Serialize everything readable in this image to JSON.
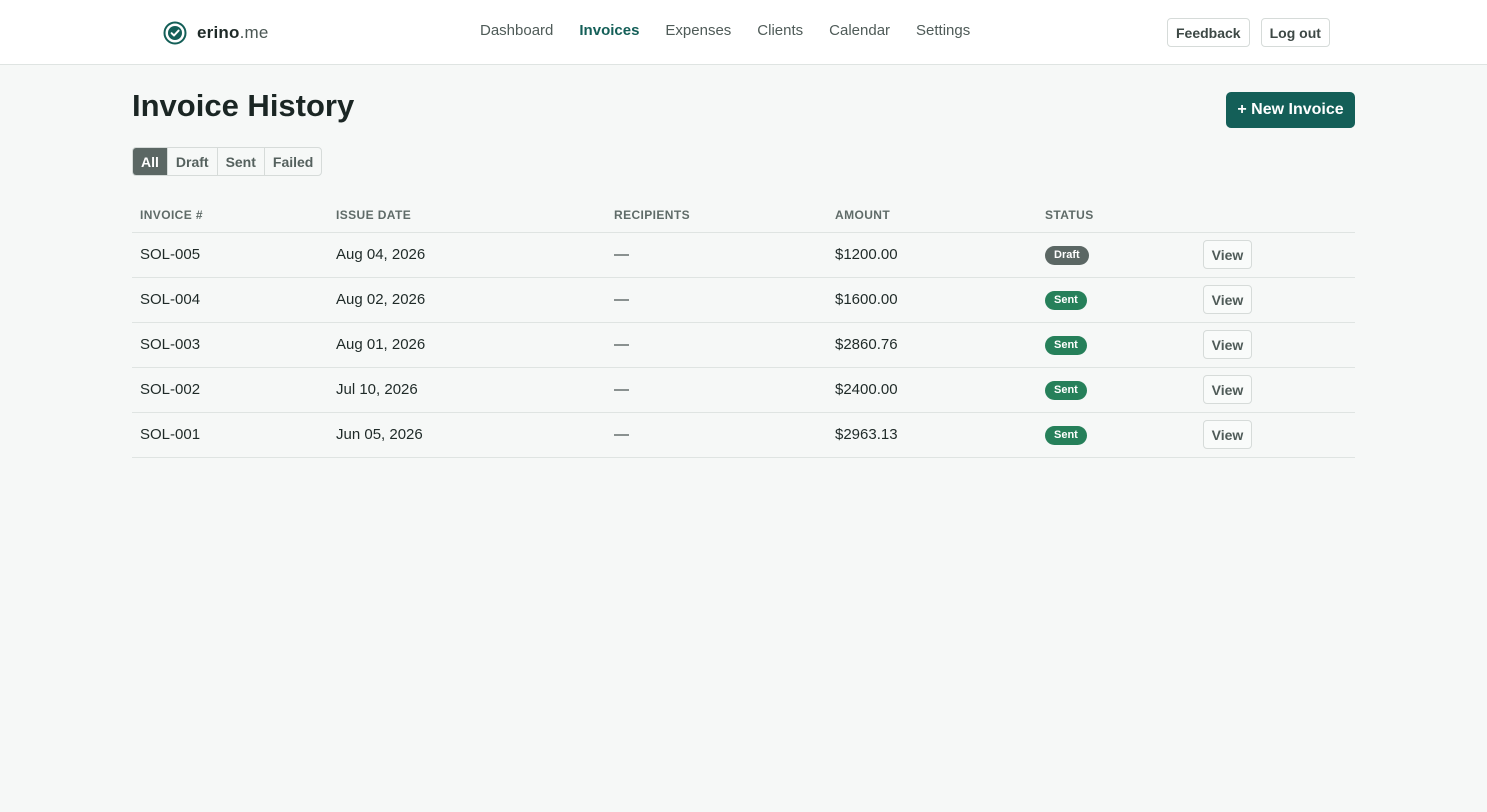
{
  "brand": {
    "name": "erino",
    "tld": ".me",
    "icon": "check-circle-icon",
    "color": "#145f58"
  },
  "nav": {
    "items": [
      {
        "label": "Dashboard",
        "active": false
      },
      {
        "label": "Invoices",
        "active": true
      },
      {
        "label": "Expenses",
        "active": false
      },
      {
        "label": "Clients",
        "active": false
      },
      {
        "label": "Calendar",
        "active": false
      },
      {
        "label": "Settings",
        "active": false
      }
    ]
  },
  "top_actions": {
    "feedback_label": "Feedback",
    "logout_label": "Log out"
  },
  "page": {
    "title": "Invoice History",
    "new_invoice_label": "+ New Invoice"
  },
  "filters": [
    "All",
    "Draft",
    "Sent",
    "Failed"
  ],
  "active_filter": "All",
  "table": {
    "headers": [
      "INVOICE #",
      "ISSUE DATE",
      "RECIPIENTS",
      "AMOUNT",
      "STATUS"
    ],
    "view_label": "View",
    "rows": [
      {
        "invoice": "SOL-005",
        "date": "Aug 04, 2026",
        "recipients": "—",
        "amount": "$1200.00",
        "status": "Draft"
      },
      {
        "invoice": "SOL-004",
        "date": "Aug 02, 2026",
        "recipients": "—",
        "amount": "$1600.00",
        "status": "Sent"
      },
      {
        "invoice": "SOL-003",
        "date": "Aug 01, 2026",
        "recipients": "—",
        "amount": "$2860.76",
        "status": "Sent"
      },
      {
        "invoice": "SOL-002",
        "date": "Jul 10, 2026",
        "recipients": "—",
        "amount": "$2400.00",
        "status": "Sent"
      },
      {
        "invoice": "SOL-001",
        "date": "Jun 05, 2026",
        "recipients": "—",
        "amount": "$2963.13",
        "status": "Sent"
      }
    ]
  },
  "colors": {
    "accent": "#145f58",
    "sent": "#26805a",
    "draft": "#5b6764",
    "background": "#f6f8f7"
  }
}
